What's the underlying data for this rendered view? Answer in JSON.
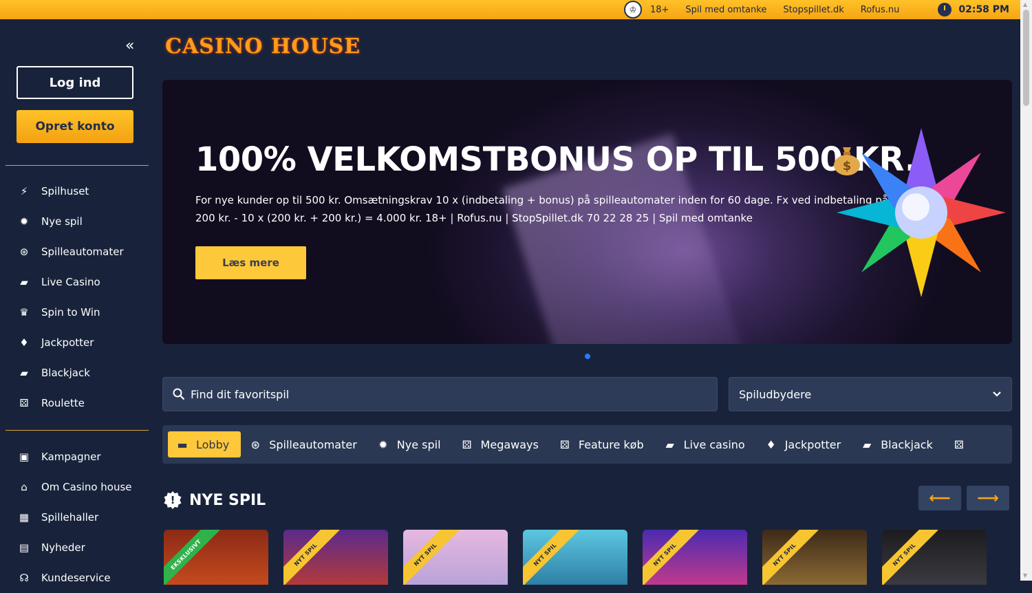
{
  "topbar": {
    "age": "18+",
    "links": [
      "Spil med omtanke",
      "Stopspillet.dk",
      "Rofus.nu"
    ],
    "time": "02:58 PM"
  },
  "brand": {
    "logo": "CASINO HOUSE"
  },
  "sidebar": {
    "login_label": "Log ind",
    "signup_label": "Opret konto",
    "nav_main": [
      {
        "label": "Spilhuset",
        "icon": "lightning-icon"
      },
      {
        "label": "Nye spil",
        "icon": "new-badge-icon"
      },
      {
        "label": "Spilleautomater",
        "icon": "slot-chip-icon"
      },
      {
        "label": "Live Casino",
        "icon": "cards-icon"
      },
      {
        "label": "Spin to Win",
        "icon": "trophy-icon"
      },
      {
        "label": "Jackpotter",
        "icon": "diamond-icon"
      },
      {
        "label": "Blackjack",
        "icon": "cards-icon"
      },
      {
        "label": "Roulette",
        "icon": "dice-icon"
      }
    ],
    "nav_secondary": [
      {
        "label": "Kampagner",
        "icon": "gift-icon"
      },
      {
        "label": "Om Casino house",
        "icon": "home-icon"
      },
      {
        "label": "Spillehaller",
        "icon": "building-icon"
      },
      {
        "label": "Nyheder",
        "icon": "newspaper-icon"
      },
      {
        "label": "Kundeservice",
        "icon": "headset-icon"
      }
    ]
  },
  "hero": {
    "title": "100% VELKOMSTBONUS OP TIL 500 KR.",
    "text": "For nye kunder op til 500 kr. Omsætningskrav 10 x (indbetaling + bonus) på spilleautomater inden for 60 dage. Fx ved indbetaling på 200 kr. - 10 x (200 kr. + 200 kr.) = 4.000 kr. 18+ | Rofus.nu | StopSpillet.dk 70 22 28 25 | Spil med omtanke",
    "button": "Læs mere"
  },
  "search": {
    "placeholder": "Find dit favoritspil"
  },
  "provider_select": {
    "selected": "Spiludbydere"
  },
  "categories": [
    {
      "label": "Lobby",
      "icon": "lobby-icon",
      "active": true
    },
    {
      "label": "Spilleautomater",
      "icon": "slot-chip-icon"
    },
    {
      "label": "Nye spil",
      "icon": "new-badge-icon"
    },
    {
      "label": "Megaways",
      "icon": "dice-icon"
    },
    {
      "label": "Feature køb",
      "icon": "dice-icon"
    },
    {
      "label": "Live casino",
      "icon": "cards-icon"
    },
    {
      "label": "Jackpotter",
      "icon": "diamond-icon"
    },
    {
      "label": "Blackjack",
      "icon": "cards-icon"
    },
    {
      "label": "",
      "icon": "dice-icon"
    }
  ],
  "section": {
    "title": "NYE SPIL"
  },
  "tiles": [
    {
      "ribbon": "EKSKLUSIVT",
      "ribbon_color": "#2fb24a",
      "bg": "#b0381c"
    },
    {
      "ribbon": "NYT SPIL",
      "ribbon_color": "#f7c531",
      "bg": "#7b3aa8"
    },
    {
      "ribbon": "NYT SPIL",
      "ribbon_color": "#f7c531",
      "bg": "#d6a7d8"
    },
    {
      "ribbon": "NYT SPIL",
      "ribbon_color": "#f7c531",
      "bg": "#3aa7c9"
    },
    {
      "ribbon": "NYT SPIL",
      "ribbon_color": "#f7c531",
      "bg": "#6a3fc4"
    },
    {
      "ribbon": "NYT SPIL",
      "ribbon_color": "#f7c531",
      "bg": "#5c3d22"
    },
    {
      "ribbon": "NYT SPIL",
      "ribbon_color": "#f7c531",
      "bg": "#2a2a2e"
    }
  ]
}
